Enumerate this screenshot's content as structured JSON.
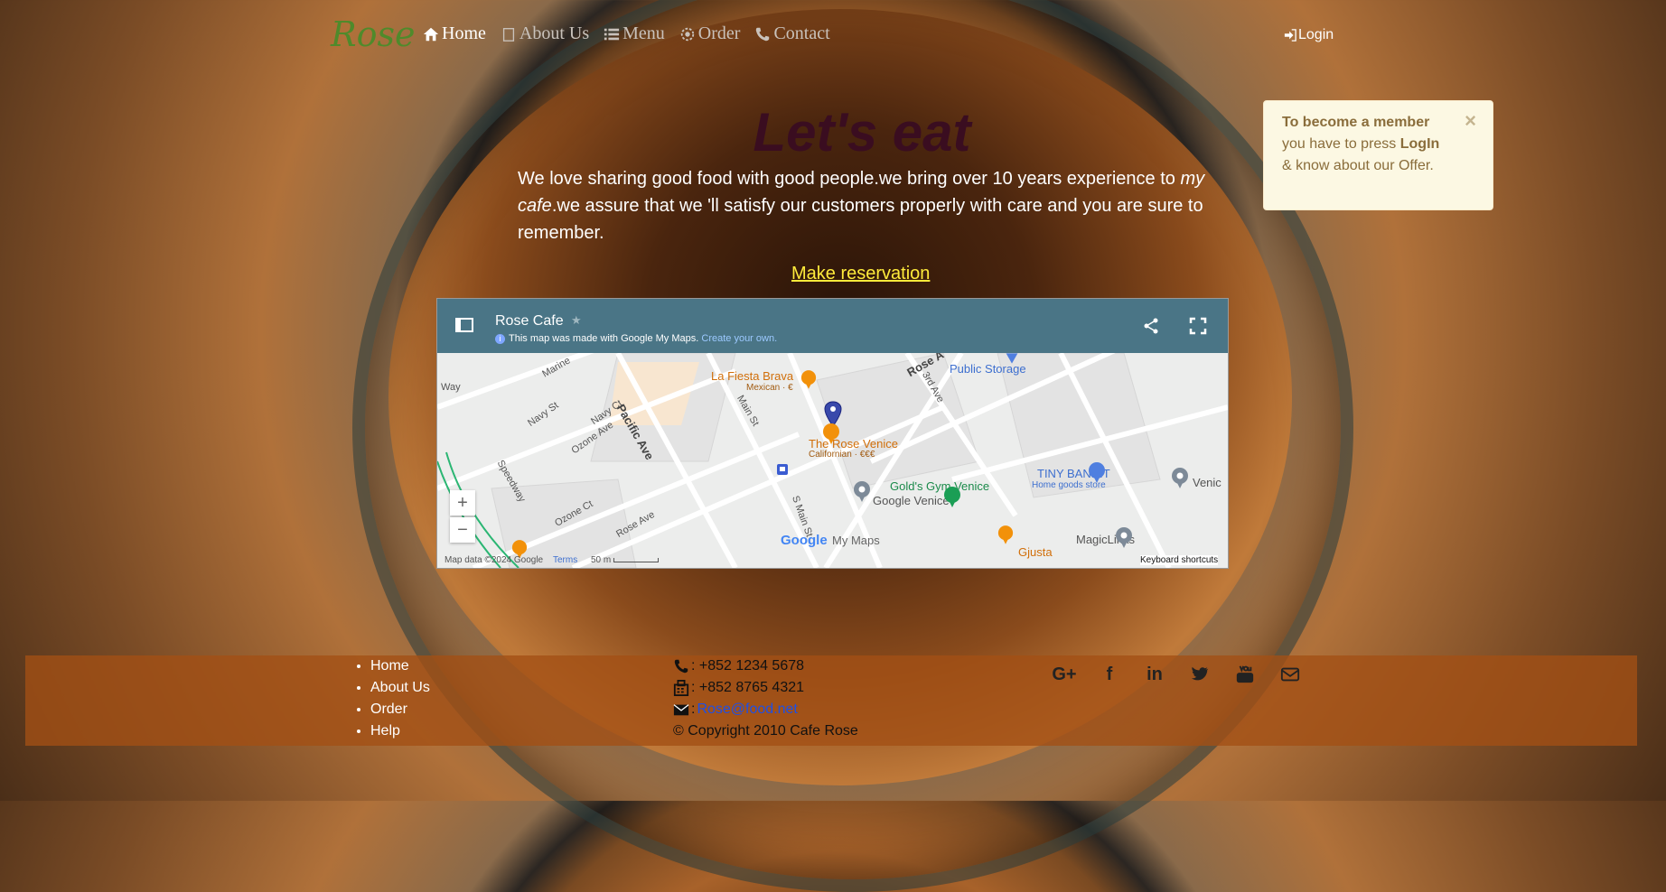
{
  "nav": {
    "brand": "Rose",
    "items": [
      {
        "label": "Home",
        "icon": "home-icon",
        "active": true
      },
      {
        "label": "About Us",
        "icon": "about-icon"
      },
      {
        "label": "Menu",
        "icon": "list-icon"
      },
      {
        "label": "Order",
        "icon": "order-icon"
      },
      {
        "label": "Contact",
        "icon": "phone-icon"
      }
    ],
    "login": "Login"
  },
  "alert": {
    "bold1": "To become a member",
    "text1": "you have to press",
    "bold2": "LogIn",
    "text2": "& know about our Offer.",
    "close": "×"
  },
  "hero": {
    "title": "Let's eat",
    "text_before": "We love sharing good food with good people.we bring over 10 years experience to ",
    "text_italic": "my cafe",
    "text_after": ".we assure that we 'll satisfy our customers properly with care and you are sure to remember.",
    "reservation_link": "Make reservation"
  },
  "map": {
    "title": "Rose Cafe",
    "note": "This map was made with Google My Maps.",
    "note_link": "Create your own.",
    "labels": {
      "way": "Way",
      "marine": "Marine",
      "navy_st": "Navy St",
      "navy_ct": "Navy Ct",
      "pacific": "Pacific Ave",
      "ozone_ave": "Ozone Ave",
      "ozone_ct": "Ozone Ct",
      "speedway": "Speedway",
      "rose_ave_low": "Rose Ave",
      "main_st": "Main St",
      "s_main": "S Main St",
      "rose_a": "Rose A",
      "third": "3rd Ave",
      "public_storage": "Public Storage",
      "fiesta": "La Fiesta Brava",
      "fiesta_sub": "Mexican · €",
      "rose_venice": "The Rose Venice",
      "rose_venice_sub": "Californian · €€€",
      "golds": "Gold's Gym Venice",
      "google_venice": "Google Venice",
      "tiny_bandit": "TINY BANDIT",
      "tiny_bandit_sub": "Home goods store",
      "magiclinks": "MagicLinks",
      "gjusta": "Gjusta",
      "venic": "Venic",
      "google": "Google",
      "my_maps": "My Maps"
    },
    "zoom_in": "+",
    "zoom_out": "−",
    "map_data": "Map data ©2024 Google",
    "terms": "Terms",
    "scale": "50 m",
    "shortcuts": "Keyboard shortcuts"
  },
  "footer": {
    "links": [
      "Home",
      "About Us",
      "Order",
      "Help"
    ],
    "phone": ": +852 1234 5678",
    "fax": ": +852 8765 4321",
    "email_sep": ":",
    "email": "Rose@food.net",
    "copyright": "© Copyright 2010 Cafe Rose",
    "social": [
      "google-plus-icon",
      "facebook-icon",
      "linkedin-icon",
      "twitter-icon",
      "youtube-icon",
      "envelope-icon"
    ]
  }
}
